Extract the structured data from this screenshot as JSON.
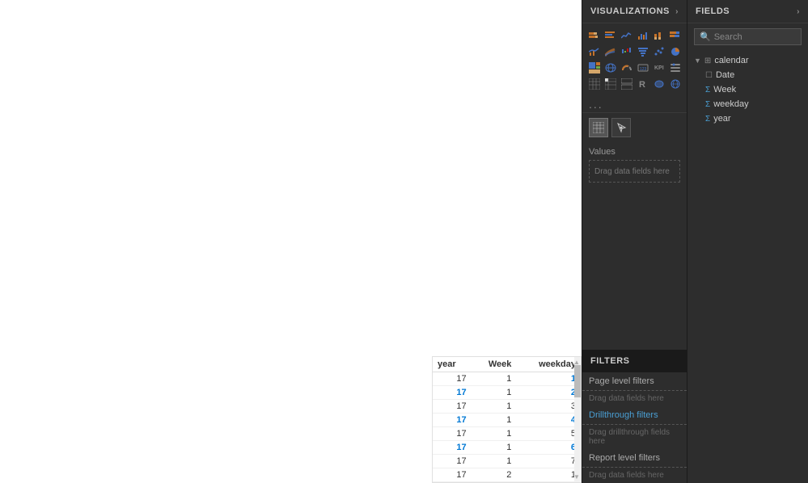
{
  "canvas": {
    "table": {
      "headers": [
        "year",
        "Week",
        "weekday"
      ],
      "rows": [
        {
          "year": "17",
          "week": "1",
          "weekday": "1",
          "yearHighlight": false,
          "wdHighlight": true
        },
        {
          "year": "17",
          "week": "1",
          "weekday": "2",
          "yearHighlight": true,
          "wdHighlight": true
        },
        {
          "year": "17",
          "week": "1",
          "weekday": "3",
          "yearHighlight": false,
          "wdHighlight": false
        },
        {
          "year": "17",
          "week": "1",
          "weekday": "4",
          "yearHighlight": true,
          "wdHighlight": true
        },
        {
          "year": "17",
          "week": "1",
          "weekday": "5",
          "yearHighlight": false,
          "wdHighlight": false
        },
        {
          "year": "17",
          "week": "1",
          "weekday": "6",
          "yearHighlight": true,
          "wdHighlight": true
        },
        {
          "year": "17",
          "week": "1",
          "weekday": "7",
          "yearHighlight": false,
          "wdHighlight": false
        },
        {
          "year": "17",
          "week": "2",
          "weekday": "1",
          "yearHighlight": false,
          "wdHighlight": false
        }
      ]
    }
  },
  "visualizations": {
    "panel_title": "VISUALIZATIONS",
    "chevron": "›",
    "more_label": "...",
    "sub_icons": [
      {
        "name": "table-icon",
        "active": true
      },
      {
        "name": "filter-icon",
        "active": false
      }
    ],
    "values_label": "Values",
    "drag_fields_label": "Drag data fields here"
  },
  "filters": {
    "section_title": "FILTERS",
    "page_level": "Page level filters",
    "drag_page": "Drag data fields here",
    "drillthrough": "Drillthrough filters",
    "drag_drillthrough": "Drag drillthrough fields here",
    "report_level": "Report level filters",
    "drag_report": "Drag data fields here"
  },
  "fields": {
    "panel_title": "FIELDS",
    "chevron": "›",
    "search_placeholder": "Search",
    "groups": [
      {
        "name": "calendar",
        "items": [
          {
            "label": "Date",
            "icon": "calendar"
          },
          {
            "label": "Week",
            "icon": "sigma"
          },
          {
            "label": "weekday",
            "icon": "sigma"
          },
          {
            "label": "year",
            "icon": "sigma"
          }
        ]
      }
    ]
  }
}
